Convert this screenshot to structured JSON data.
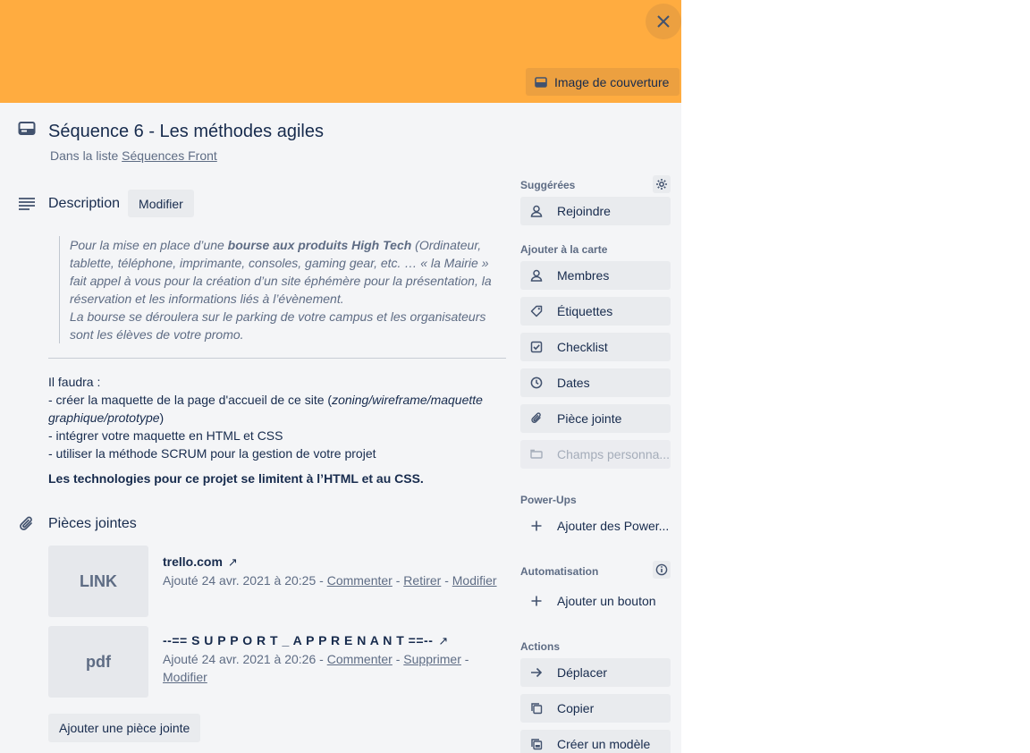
{
  "colors": {
    "cover": "#ffac40",
    "card_bg": "#f4f5f7"
  },
  "cover": {
    "button_label": "Image de couverture",
    "close_icon": "close-icon"
  },
  "card": {
    "title": "Séquence 6 - Les méthodes agiles",
    "in_list_prefix": "Dans la liste",
    "list_name": "Séquences Front"
  },
  "description": {
    "heading": "Description",
    "modify_label": "Modifier",
    "quote": {
      "part1": "Pour la mise en place d’une ",
      "bold": "bourse aux produits High Tech",
      "part2": " (Ordinateur, tablette, téléphone, imprimante, consoles, gaming gear, etc. … « la Mairie » fait appel à vous pour la création d’un site éphémère pour la présentation, la réservation et les informations liés à l’évènement.",
      "part3": "La bourse se déroulera sur le parking de votre campus et les organisateurs sont les élèves de votre promo."
    },
    "body": {
      "line1": "Il faudra :",
      "line2_prefix": "- créer la maquette de la page d'accueil de ce site (",
      "line2_italic": "zoning/wireframe/maquette graphique/prototype",
      "line2_suffix": ")",
      "line3": "- intégrer votre maquette en HTML et CSS",
      "line4": "- utiliser la méthode SCRUM pour la gestion de votre projet",
      "bold_line": "Les technologies pour ce projet se limitent à l’HTML et au CSS."
    }
  },
  "attachments": {
    "heading": "Pièces jointes",
    "add_label": "Ajouter une pièce jointe",
    "items": [
      {
        "thumb": "LINK",
        "name": "trello.com",
        "added": "Ajouté 24 avr. 2021 à 20:25",
        "actions": [
          "Commenter",
          "Retirer",
          "Modifier"
        ]
      },
      {
        "thumb": "pdf",
        "name": "--== S U P P O R T _ A P P R E N A N T ==--",
        "added": "Ajouté 24 avr. 2021 à 20:26",
        "actions": [
          "Commenter",
          "Supprimer",
          "Modifier"
        ]
      }
    ]
  },
  "sidebar": {
    "suggested_label": "Suggérées",
    "join": "Rejoindre",
    "add_to_card_label": "Ajouter à la carte",
    "members": "Membres",
    "labels": "Étiquettes",
    "checklist": "Checklist",
    "dates": "Dates",
    "attachment": "Pièce jointe",
    "custom_fields": "Champs personna...",
    "powerups_label": "Power-Ups",
    "add_powerups": "Ajouter des Power...",
    "automation_label": "Automatisation",
    "add_button": "Ajouter un bouton",
    "actions_label": "Actions",
    "move": "Déplacer",
    "copy": "Copier",
    "make_template": "Créer un modèle"
  }
}
